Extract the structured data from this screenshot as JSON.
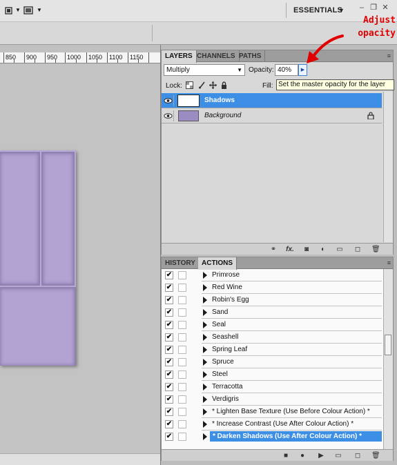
{
  "appbar": {
    "workspace_label": "ESSENTIALS",
    "workspace_arrow": "▼",
    "minimize": "–",
    "restore": "❐",
    "close": "✕"
  },
  "ruler": {
    "ticks": [
      "850",
      "900",
      "950",
      "1000",
      "1050",
      "1100",
      "1150"
    ]
  },
  "annotation": {
    "line1": "Adjust",
    "line2": "opacity",
    "color": "#e00000"
  },
  "layers_panel": {
    "tabs": [
      "LAYERS",
      "CHANNELS",
      "PATHS"
    ],
    "active_tab": "LAYERS",
    "menu_icon": "≡",
    "blend_mode": "Multiply",
    "opacity_label": "Opacity:",
    "opacity_value": "40%",
    "lock_label": "Lock:",
    "fill_label": "Fill:",
    "tooltip": "Set the master opacity for the layer",
    "layers": [
      {
        "name": "Shadows",
        "selected": true,
        "italic": false
      },
      {
        "name": "Background",
        "selected": false,
        "italic": true,
        "locked": true
      }
    ],
    "footer_icons": [
      "link-icon",
      "fx-icon",
      "mask-icon",
      "adjustment-icon",
      "group-icon",
      "new-layer-icon",
      "trash-icon"
    ],
    "footer_glyphs": {
      "fx": "fx."
    }
  },
  "actions_panel": {
    "tabs": [
      "HISTORY",
      "ACTIONS"
    ],
    "active_tab": "ACTIONS",
    "menu_icon": "≡",
    "check_glyph": "✔",
    "actions": [
      "Primrose",
      "Red Wine",
      "Robin's Egg",
      "Sand",
      "Seal",
      "Seashell",
      "Spring Leaf",
      "Spruce",
      "Steel",
      "Terracotta",
      "Verdigris",
      "* Lighten Base Texture (Use Before Colour Action) *",
      "* Increase Contrast (Use After Colour Action) *",
      "* Darken Shadows (Use After Colour Action) *"
    ],
    "selected_action": "* Darken Shadows (Use After Colour Action) *",
    "footer_icons": [
      "stop-icon",
      "record-icon",
      "play-icon",
      "new-set-icon",
      "new-action-icon",
      "trash-icon"
    ]
  },
  "colors": {
    "selection": "#3d8ee5",
    "canvas_art": "#b7a8d6",
    "panel_bg": "#d8d8d8",
    "tooltip_bg": "#ffffe1"
  }
}
